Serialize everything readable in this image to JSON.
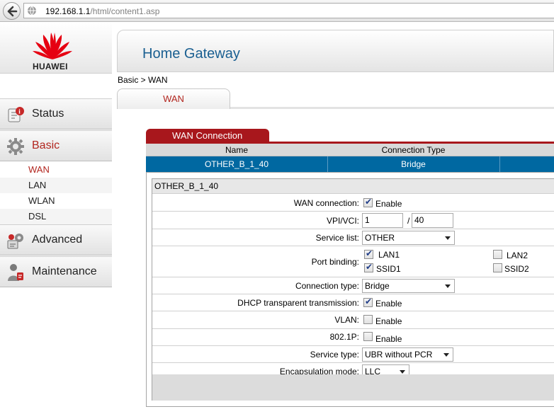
{
  "browser": {
    "url_host": "192.168.1.1",
    "url_path": "/html/content1.asp"
  },
  "brand": {
    "logo_text": "HUAWEI",
    "logo_color": "#e60012"
  },
  "sidebar": {
    "items": [
      {
        "label": "Status",
        "icon": "status-icon"
      },
      {
        "label": "Basic",
        "icon": "basic-icon",
        "active": true,
        "subitems": [
          "WAN",
          "LAN",
          "WLAN",
          "DSL"
        ]
      },
      {
        "label": "Advanced",
        "icon": "advanced-icon"
      },
      {
        "label": "Maintenance",
        "icon": "maintenance-icon"
      }
    ]
  },
  "header": {
    "title": "Home Gateway",
    "breadcrumb": "Basic > WAN",
    "tab": "WAN"
  },
  "wan_table": {
    "panel_title": "WAN Connection",
    "columns": [
      "Name",
      "Connection Type"
    ],
    "rows": [
      {
        "name": "OTHER_B_1_40",
        "type": "Bridge",
        "selected": true
      }
    ]
  },
  "details": {
    "title": "OTHER_B_1_40",
    "wan_connection": {
      "label": "WAN connection:",
      "checkbox_label": "Enable",
      "checked": true
    },
    "vpi_vci": {
      "label": "VPI/VCI:",
      "vpi": "1",
      "separator": "/",
      "vci": "40"
    },
    "service_list": {
      "label": "Service list:",
      "value": "OTHER"
    },
    "port_binding": {
      "label": "Port binding:",
      "ports": [
        {
          "name": "LAN1",
          "checked": true
        },
        {
          "name": "LAN2",
          "checked": false
        },
        {
          "name": "SSID1",
          "checked": true
        },
        {
          "name": "SSID2",
          "checked": false
        }
      ]
    },
    "connection_type": {
      "label": "Connection type:",
      "value": "Bridge"
    },
    "dhcp_transparent": {
      "label": "DHCP transparent transmission:",
      "checkbox_label": "Enable",
      "checked": true
    },
    "vlan": {
      "label": "VLAN:",
      "checkbox_label": "Enable",
      "checked": false
    },
    "dot1p": {
      "label": "802.1P:",
      "checkbox_label": "Enable",
      "checked": false
    },
    "service_type": {
      "label": "Service type:",
      "value": "UBR without PCR"
    },
    "encapsulation_mode": {
      "label": "Encapsulation mode:",
      "value": "LLC"
    }
  },
  "colors": {
    "accent_red": "#a8171c",
    "selected_row_blue": "#0068a1",
    "title_blue": "#1a5f91"
  }
}
